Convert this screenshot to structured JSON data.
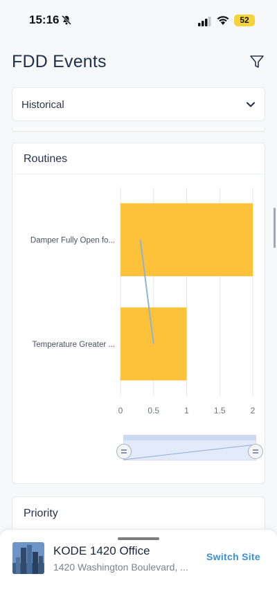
{
  "status_bar": {
    "time": "15:16",
    "battery": "52"
  },
  "header": {
    "title": "FDD Events",
    "filter_icon": "filter-icon"
  },
  "period_select": {
    "value": "Historical"
  },
  "routines_card": {
    "title": "Routines"
  },
  "chart_data": {
    "type": "bar",
    "orientation": "horizontal",
    "categories": [
      "Damper Fully Open fo...",
      "Temperature Greater ..."
    ],
    "values": [
      2,
      1
    ],
    "x_ticks": [
      "0",
      "0.5",
      "1",
      "1.5",
      "2"
    ],
    "xlim": [
      0,
      2
    ],
    "bar_color": "#fec23a",
    "grid": true,
    "line_overlay": [
      0.3,
      0.5
    ]
  },
  "priority_card": {
    "title": "Priority"
  },
  "site": {
    "name": "KODE 1420 Office",
    "address": "1420 Washington Boulevard, ...",
    "switch_label": "Switch Site"
  },
  "colors": {
    "accent": "#3b8fd6",
    "bar": "#fec23a",
    "battery": "#f6d33a"
  }
}
